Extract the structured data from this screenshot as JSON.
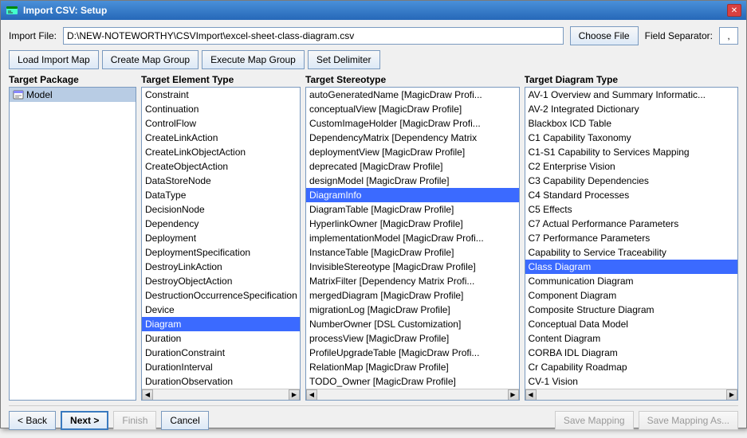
{
  "window": {
    "title": "Import CSV: Setup",
    "icon": "csv-icon"
  },
  "importFile": {
    "label": "Import File:",
    "value": "D:\\NEW-NOTEWORTHY\\CSVImport\\excel-sheet-class-diagram.csv",
    "chooseFileLabel": "Choose File",
    "fieldSeparatorLabel": "Field Separator:",
    "fieldSeparatorValue": ","
  },
  "toolbar": {
    "loadImportMapLabel": "Load Import Map",
    "createMapGroupLabel": "Create Map Group",
    "executeMapGroupLabel": "Execute Map Group",
    "setDelimiterLabel": "Set Delimiter"
  },
  "panels": {
    "targetPackage": {
      "title": "Target Package",
      "items": [
        {
          "label": "Model",
          "selected": true
        }
      ]
    },
    "targetElementType": {
      "title": "Target Element Type",
      "items": [
        {
          "label": "Constraint"
        },
        {
          "label": "Continuation"
        },
        {
          "label": "ControlFlow"
        },
        {
          "label": "CreateLinkAction"
        },
        {
          "label": "CreateLinkObjectAction"
        },
        {
          "label": "CreateObjectAction"
        },
        {
          "label": "DataStoreNode"
        },
        {
          "label": "DataType"
        },
        {
          "label": "DecisionNode"
        },
        {
          "label": "Dependency"
        },
        {
          "label": "Deployment"
        },
        {
          "label": "DeploymentSpecification"
        },
        {
          "label": "DestroyLinkAction"
        },
        {
          "label": "DestroyObjectAction"
        },
        {
          "label": "DestructionOccurrenceSpecification"
        },
        {
          "label": "Device"
        },
        {
          "label": "Diagram",
          "selected": true
        },
        {
          "label": "Duration"
        },
        {
          "label": "DurationConstraint"
        },
        {
          "label": "DurationInterval"
        },
        {
          "label": "DurationObservation"
        }
      ]
    },
    "targetStereotype": {
      "title": "Target Stereotype",
      "items": [
        {
          "label": "autoGeneratedName [MagicDraw Profi..."
        },
        {
          "label": "conceptualView [MagicDraw Profile]"
        },
        {
          "label": "CustomImageHolder [MagicDraw Profi..."
        },
        {
          "label": "DependencyMatrix [Dependency Matrix"
        },
        {
          "label": "deploymentView [MagicDraw Profile]"
        },
        {
          "label": "deprecated [MagicDraw Profile]"
        },
        {
          "label": "designModel [MagicDraw Profile]"
        },
        {
          "label": "DiagramInfo",
          "selected": true
        },
        {
          "label": "DiagramTable [MagicDraw Profile]"
        },
        {
          "label": "HyperlinkOwner [MagicDraw Profile]"
        },
        {
          "label": "implementationModel [MagicDraw Profi..."
        },
        {
          "label": "InstanceTable [MagicDraw Profile]"
        },
        {
          "label": "InvisibleStereotype [MagicDraw Profile]"
        },
        {
          "label": "MatrixFilter [Dependency Matrix Profi..."
        },
        {
          "label": "mergedDiagram [MagicDraw Profile]"
        },
        {
          "label": "migrationLog [MagicDraw Profile]"
        },
        {
          "label": "NumberOwner [DSL Customization]"
        },
        {
          "label": "processView [MagicDraw Profile]"
        },
        {
          "label": "ProfileUpgradeTable [MagicDraw Profi..."
        },
        {
          "label": "RelationMap [MagicDraw Profile]"
        },
        {
          "label": "TODO_Owner [MagicDraw Profile]"
        }
      ]
    },
    "targetDiagramType": {
      "title": "Target Diagram Type",
      "items": [
        {
          "label": "AV-1 Overview and Summary Informatic..."
        },
        {
          "label": "AV-2 Integrated Dictionary"
        },
        {
          "label": "Blackbox ICD Table"
        },
        {
          "label": "C1 Capability Taxonomy"
        },
        {
          "label": "C1-S1 Capability to Services Mapping"
        },
        {
          "label": "C2 Enterprise Vision"
        },
        {
          "label": "C3 Capability Dependencies"
        },
        {
          "label": "C4 Standard Processes"
        },
        {
          "label": "C5 Effects"
        },
        {
          "label": "C7 Actual Performance Parameters"
        },
        {
          "label": "C7 Performance Parameters"
        },
        {
          "label": "Capability to Service Traceability"
        },
        {
          "label": "Class Diagram",
          "selected": true
        },
        {
          "label": "Communication Diagram"
        },
        {
          "label": "Component Diagram"
        },
        {
          "label": "Composite Structure Diagram"
        },
        {
          "label": "Conceptual Data Model"
        },
        {
          "label": "Content Diagram"
        },
        {
          "label": "CORBA IDL Diagram"
        },
        {
          "label": "Cr Capability Roadmap"
        },
        {
          "label": "CV-1 Vision"
        }
      ]
    }
  },
  "bottomButtons": {
    "backLabel": "< Back",
    "nextLabel": "Next >",
    "finishLabel": "Finish",
    "cancelLabel": "Cancel",
    "saveMappingLabel": "Save Mapping",
    "saveMappingAsLabel": "Save Mapping As..."
  }
}
